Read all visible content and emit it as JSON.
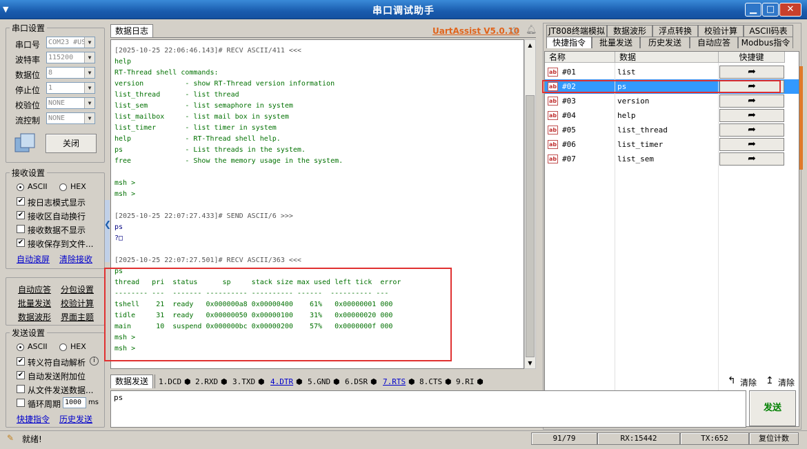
{
  "window": {
    "title": "串口调试助手",
    "sysmenu": "▼",
    "min": "▁",
    "max": "□",
    "close": "✕"
  },
  "serial": {
    "group_title": "串口设置",
    "port_label": "串口号",
    "port_value": "COM23 #US",
    "baud_label": "波特率",
    "baud_value": "115200",
    "data_label": "数据位",
    "data_value": "8",
    "stop_label": "停止位",
    "stop_value": "1",
    "parity_label": "校验位",
    "parity_value": "NONE",
    "flow_label": "流控制",
    "flow_value": "NONE",
    "close_button": "关闭"
  },
  "receive": {
    "group_title": "接收设置",
    "ascii": "ASCII",
    "hex": "HEX",
    "opt1": "按日志模式显示",
    "opt2": "接收区自动换行",
    "opt3": "接收数据不显示",
    "opt4": "接收保存到文件...",
    "link_autoscroll": "自动滚屏",
    "link_clear": "清除接收"
  },
  "tools": {
    "auto_reply": "自动应答",
    "split_display": "分包设置",
    "batch_send": "批量发送",
    "checksum": "校验计算",
    "waveform": "数据波形",
    "theme": "界面主题"
  },
  "send_settings": {
    "group_title": "发送设置",
    "ascii": "ASCII",
    "hex": "HEX",
    "opt1": "转义符自动解析",
    "opt2": "自动发送附加位",
    "opt3": "从文件发送数据...",
    "opt4": "循环周期",
    "period_value": "1000",
    "period_unit": "ms",
    "link_quick": "快捷指令",
    "link_history": "历史发送"
  },
  "log": {
    "tab_label": "数据日志",
    "brand": "UartAssist V5.0.10",
    "lines": [
      {
        "t": "[2025-10-25 22:06:46.143]# RECV ASCII/411 <<<",
        "c": "gray"
      },
      {
        "t": "help",
        "c": "green"
      },
      {
        "t": "RT-Thread shell commands:",
        "c": "green"
      },
      {
        "t": "version          - show RT-Thread version information",
        "c": "green"
      },
      {
        "t": "list_thread      - list thread",
        "c": "green"
      },
      {
        "t": "list_sem         - list semaphore in system",
        "c": "green"
      },
      {
        "t": "list_mailbox     - list mail box in system",
        "c": "green"
      },
      {
        "t": "list_timer       - list timer in system",
        "c": "green"
      },
      {
        "t": "help             - RT-Thread shell help.",
        "c": "green"
      },
      {
        "t": "ps               - List threads in the system.",
        "c": "green"
      },
      {
        "t": "free             - Show the memory usage in the system.",
        "c": "green"
      },
      {
        "t": "",
        "c": "green"
      },
      {
        "t": "msh >",
        "c": "green"
      },
      {
        "t": "msh >",
        "c": "green"
      },
      {
        "t": "",
        "c": "green"
      },
      {
        "t": "[2025-10-25 22:07:27.433]# SEND ASCII/6 >>>",
        "c": "gray"
      },
      {
        "t": "ps",
        "c": "blue"
      },
      {
        "t": "?□",
        "c": "blue"
      },
      {
        "t": "",
        "c": "green"
      },
      {
        "t": "[2025-10-25 22:07:27.501]# RECV ASCII/363 <<<",
        "c": "gray"
      },
      {
        "t": "ps",
        "c": "green"
      },
      {
        "t": "thread   pri  status      sp     stack size max used left tick  error",
        "c": "green"
      },
      {
        "t": "-------- ---  ------- ---------- ---------- ------  ---------- ---",
        "c": "green"
      },
      {
        "t": "tshell    21  ready   0x000000a8 0x00000400    61%   0x00000001 000",
        "c": "green"
      },
      {
        "t": "tidle     31  ready   0x00000050 0x00000100    31%   0x00000020 000",
        "c": "green"
      },
      {
        "t": "main      10  suspend 0x000000bc 0x00000200    57%   0x0000000f 000",
        "c": "green"
      },
      {
        "t": "msh >",
        "c": "green"
      },
      {
        "t": "msh >",
        "c": "green"
      }
    ]
  },
  "right_tabs_row1": [
    "JT808终端模拟",
    "数据波形",
    "浮点转换",
    "校验计算",
    "ASCII码表"
  ],
  "right_tabs_row2": [
    "快捷指令",
    "批量发送",
    "历史发送",
    "自动应答",
    "Modbus指令"
  ],
  "quick": {
    "headers": [
      "名称",
      "数据",
      "快捷键"
    ],
    "rows": [
      {
        "num": "#01",
        "data": "list"
      },
      {
        "num": "#02",
        "data": "ps"
      },
      {
        "num": "#03",
        "data": "version"
      },
      {
        "num": "#04",
        "data": "help"
      },
      {
        "num": "#05",
        "data": "list_thread"
      },
      {
        "num": "#06",
        "data": "list_timer"
      },
      {
        "num": "#07",
        "data": "list_sem"
      }
    ],
    "selected_index": 1,
    "icon_text": "ab",
    "go_glyph": "➦"
  },
  "send": {
    "tab_label": "数据发送",
    "signals": [
      "1.DCD",
      "2.RXD",
      "3.TXD",
      "4.DTR",
      "5.GND",
      "6.DSR",
      "7.RTS",
      "8.CTS",
      "9.RI"
    ],
    "clear1": "清除",
    "clear2": "清除",
    "text": "ps",
    "send_button": "发送"
  },
  "status": {
    "ready": "就绪!",
    "count": "91/79",
    "rx": "RX:15442",
    "tx": "TX:652",
    "reset": "复位计数"
  },
  "colors": {
    "accent": "#1a5cae",
    "brand": "#e0641c",
    "highlight": "#e03030",
    "selection": "#3399ff"
  }
}
